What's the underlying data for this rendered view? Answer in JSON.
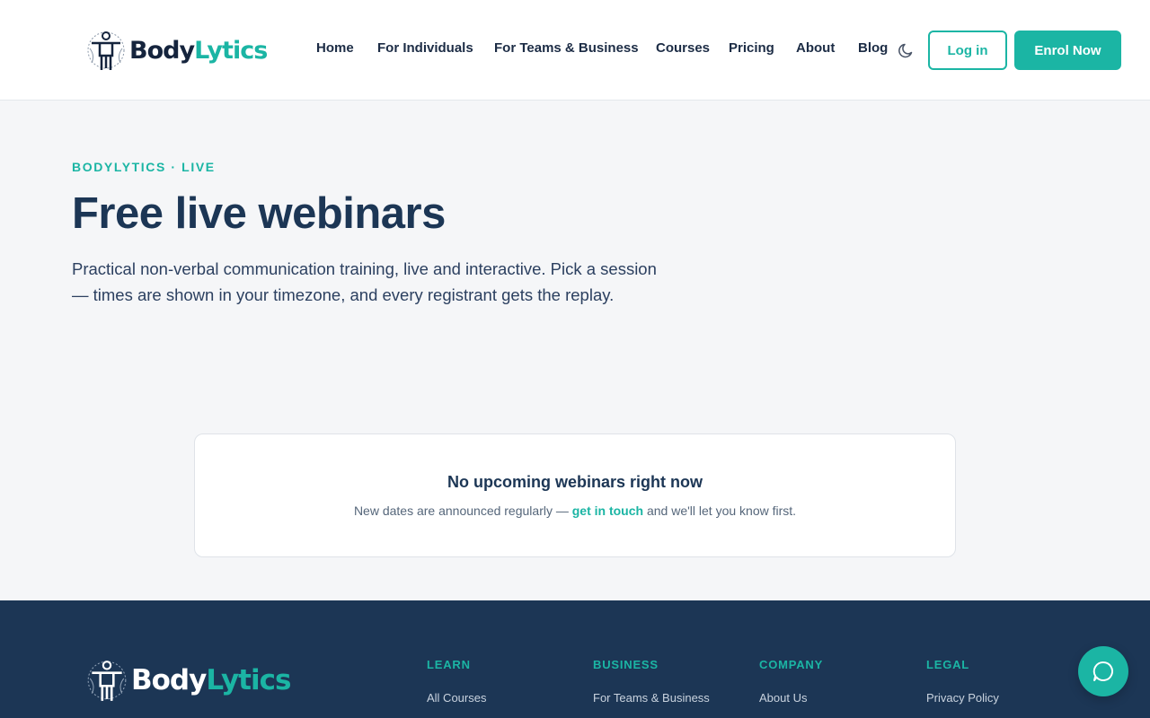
{
  "brand": {
    "name_part1": "Body",
    "name_part2": "Lytics",
    "accent_color": "#1bb5a4",
    "dark_color": "#1c3655"
  },
  "header": {
    "nav": [
      {
        "label": "Home"
      },
      {
        "label": "For Individuals"
      },
      {
        "label": "For Teams & Business"
      },
      {
        "label": "Courses"
      },
      {
        "label": "Pricing"
      },
      {
        "label": "About"
      },
      {
        "label": "Blog"
      }
    ],
    "theme_toggle_icon": "moon-icon",
    "login_label": "Log in",
    "enrol_label": "Enrol Now"
  },
  "hero": {
    "eyebrow": "BODYLYTICS · LIVE",
    "title": "Free live webinars",
    "description": "Practical non-verbal communication training, live and interactive. Pick a session — times are shown in your timezone, and every registrant gets the replay."
  },
  "empty_state": {
    "title": "No upcoming webinars right now",
    "text_before": "New dates are announced regularly — ",
    "link": "get in touch",
    "text_after": " and we'll let you know first."
  },
  "footer": {
    "columns": [
      {
        "heading": "LEARN",
        "links": [
          "All Courses"
        ]
      },
      {
        "heading": "BUSINESS",
        "links": [
          "For Teams & Business"
        ]
      },
      {
        "heading": "COMPANY",
        "links": [
          "About Us"
        ]
      },
      {
        "heading": "LEGAL",
        "links": [
          "Privacy Policy"
        ]
      }
    ]
  },
  "chat": {
    "icon": "chat-bubble-icon"
  }
}
